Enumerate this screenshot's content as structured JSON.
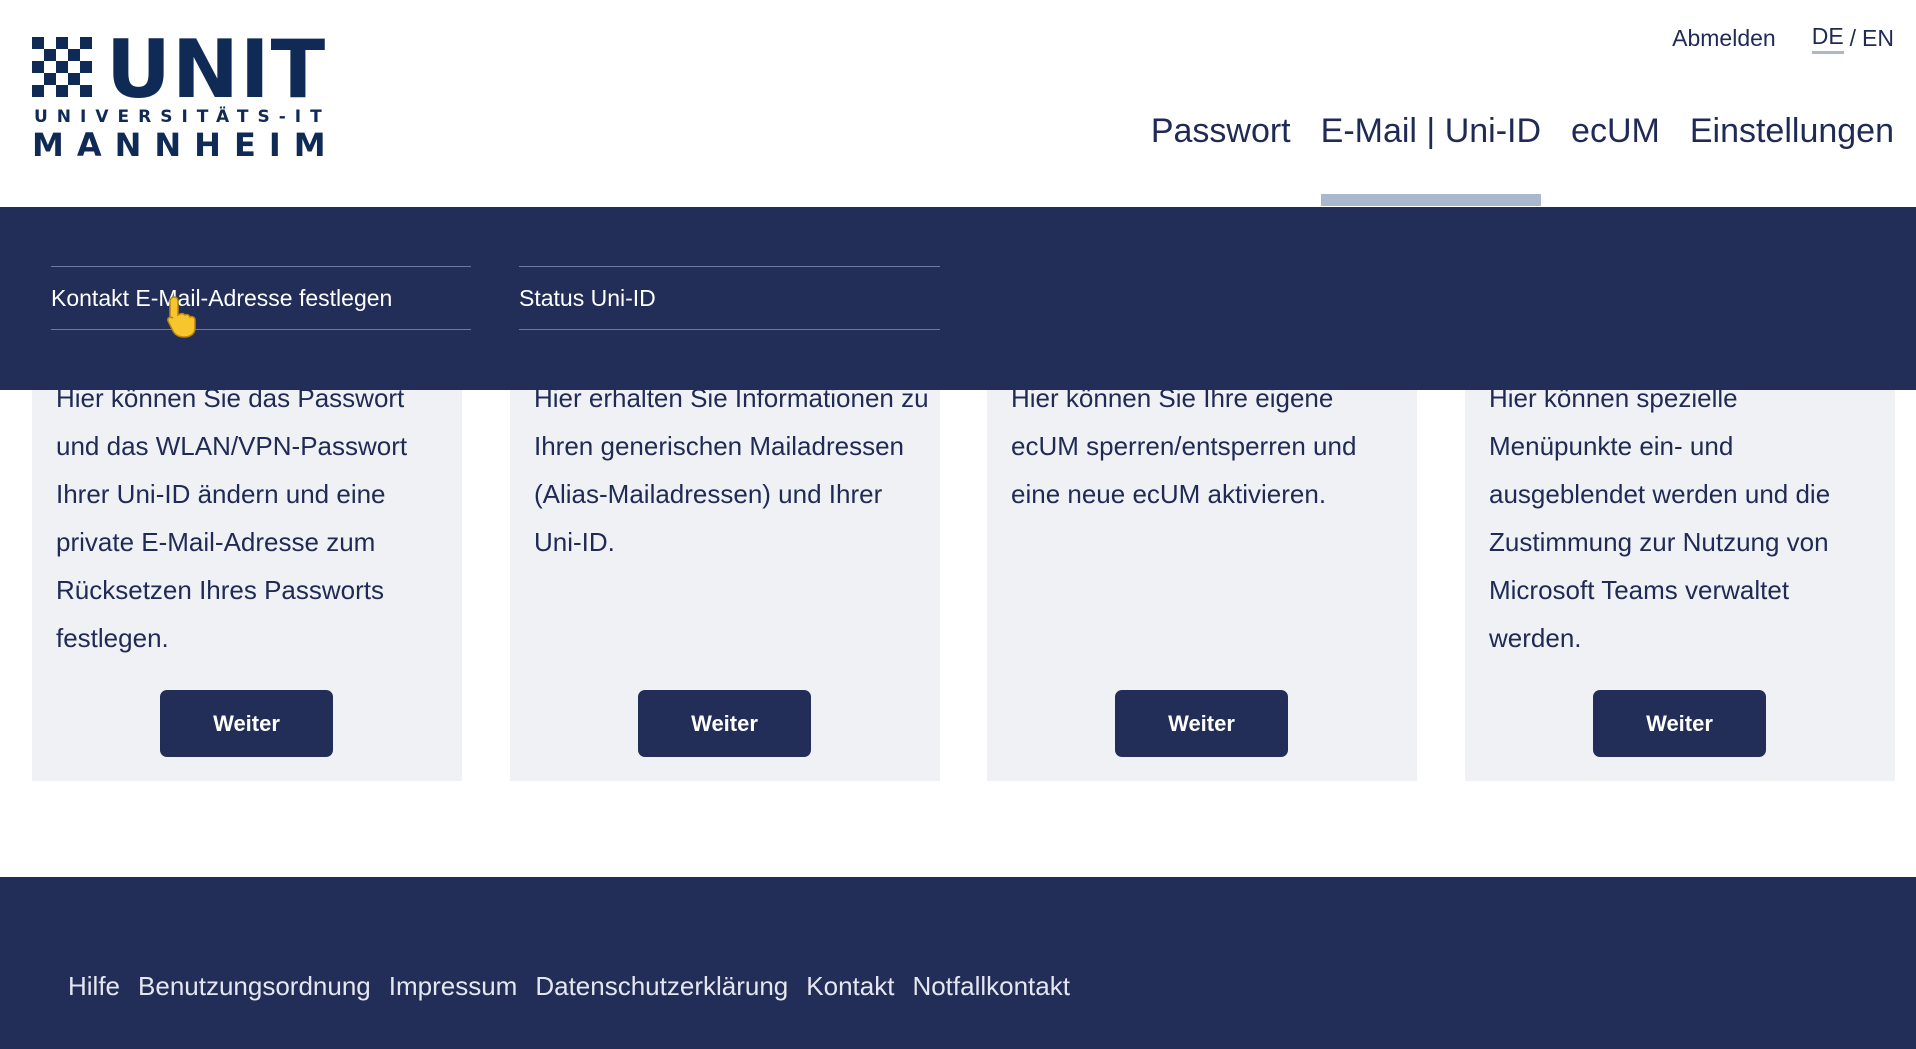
{
  "header": {
    "logo": {
      "wordmark": "UNIT",
      "subtitle": "UNIVERSITÄTS-IT",
      "city": "MANNHEIM"
    },
    "logout_label": "Abmelden",
    "lang": {
      "de": "DE",
      "separator": "/",
      "en": "EN",
      "active": "DE"
    },
    "nav": [
      {
        "label": "Passwort"
      },
      {
        "label": "E-Mail | Uni-ID",
        "active": true
      },
      {
        "label": "ecUM"
      },
      {
        "label": "Einstellungen"
      }
    ]
  },
  "subnav": {
    "items": [
      {
        "label": "Kontakt E-Mail-Adresse festlegen"
      },
      {
        "label": "Status Uni-ID"
      }
    ]
  },
  "cards": [
    {
      "text": "Hier können Sie das Passwort und das WLAN/VPN-Passwort Ihrer Uni-ID ändern und eine private E-Mail-Adresse zum Rücksetzen Ihres Passworts festlegen.",
      "button": "Weiter"
    },
    {
      "text": "Hier erhalten Sie Informationen zu Ihren generischen Mailadressen (Alias-Mailadressen) und Ihrer Uni-ID.",
      "button": "Weiter"
    },
    {
      "text": "Hier können Sie Ihre eigene ecUM sperren/entsperren und eine neue ecUM aktivieren.",
      "button": "Weiter"
    },
    {
      "text": "Hier können spezielle Menüpunkte ein- und ausgeblendet werden und die Zustimmung zur Nutzung von Microsoft Teams verwaltet werden.",
      "button": "Weiter"
    }
  ],
  "footer": {
    "links": [
      "Hilfe",
      "Benutzungsordnung",
      "Impressum",
      "Datenschutzerklärung",
      "Kontakt",
      "Notfallkontakt"
    ]
  },
  "colors": {
    "primary": "#222d58",
    "accent": "#a9b8cc",
    "card_bg": "#f0f1f5",
    "text": "#1f2a55"
  },
  "icons": {
    "cursor": "pointing-hand-cursor-icon",
    "logo_mark": "checkerboard-logo-icon"
  }
}
